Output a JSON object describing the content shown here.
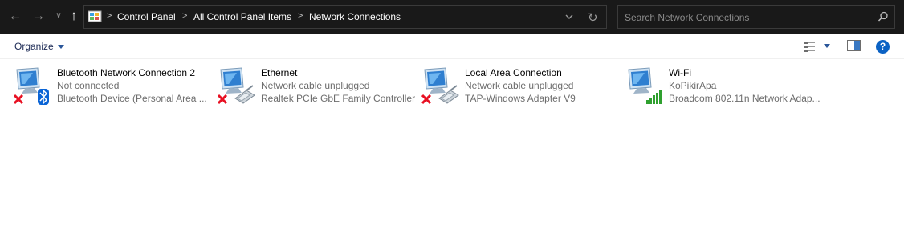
{
  "window": {
    "title": "Network Connections"
  },
  "address_bar": {
    "breadcrumbs": [
      "Control Panel",
      "All Control Panel Items",
      "Network Connections"
    ],
    "icon": "control-panel-icon"
  },
  "search": {
    "placeholder": "Search Network Connections",
    "value": ""
  },
  "toolbar": {
    "organize_label": "Organize"
  },
  "connections": [
    {
      "name": "Bluetooth Network Connection 2",
      "status": "Not connected",
      "device": "Bluetooth Device (Personal Area ...",
      "icon": "bluetooth-network-icon",
      "overlay": "disconnected-x-icon"
    },
    {
      "name": "Ethernet",
      "status": "Network cable unplugged",
      "device": "Realtek PCIe GbE Family Controller",
      "icon": "ethernet-network-icon",
      "overlay": "disconnected-x-icon"
    },
    {
      "name": "Local Area Connection",
      "status": "Network cable unplugged",
      "device": "TAP-Windows Adapter V9",
      "icon": "ethernet-network-icon",
      "overlay": "disconnected-x-icon"
    },
    {
      "name": "Wi-Fi",
      "status": "KoPikirApa",
      "device": "Broadcom 802.11n Network Adap...",
      "icon": "wifi-network-icon",
      "overlay": "signal-bars-icon"
    }
  ],
  "colors": {
    "address_bar_bg": "#191919",
    "accent": "#2b579a",
    "help": "#0b62c4",
    "signal": "#2fa02f",
    "error": "#e81123"
  }
}
